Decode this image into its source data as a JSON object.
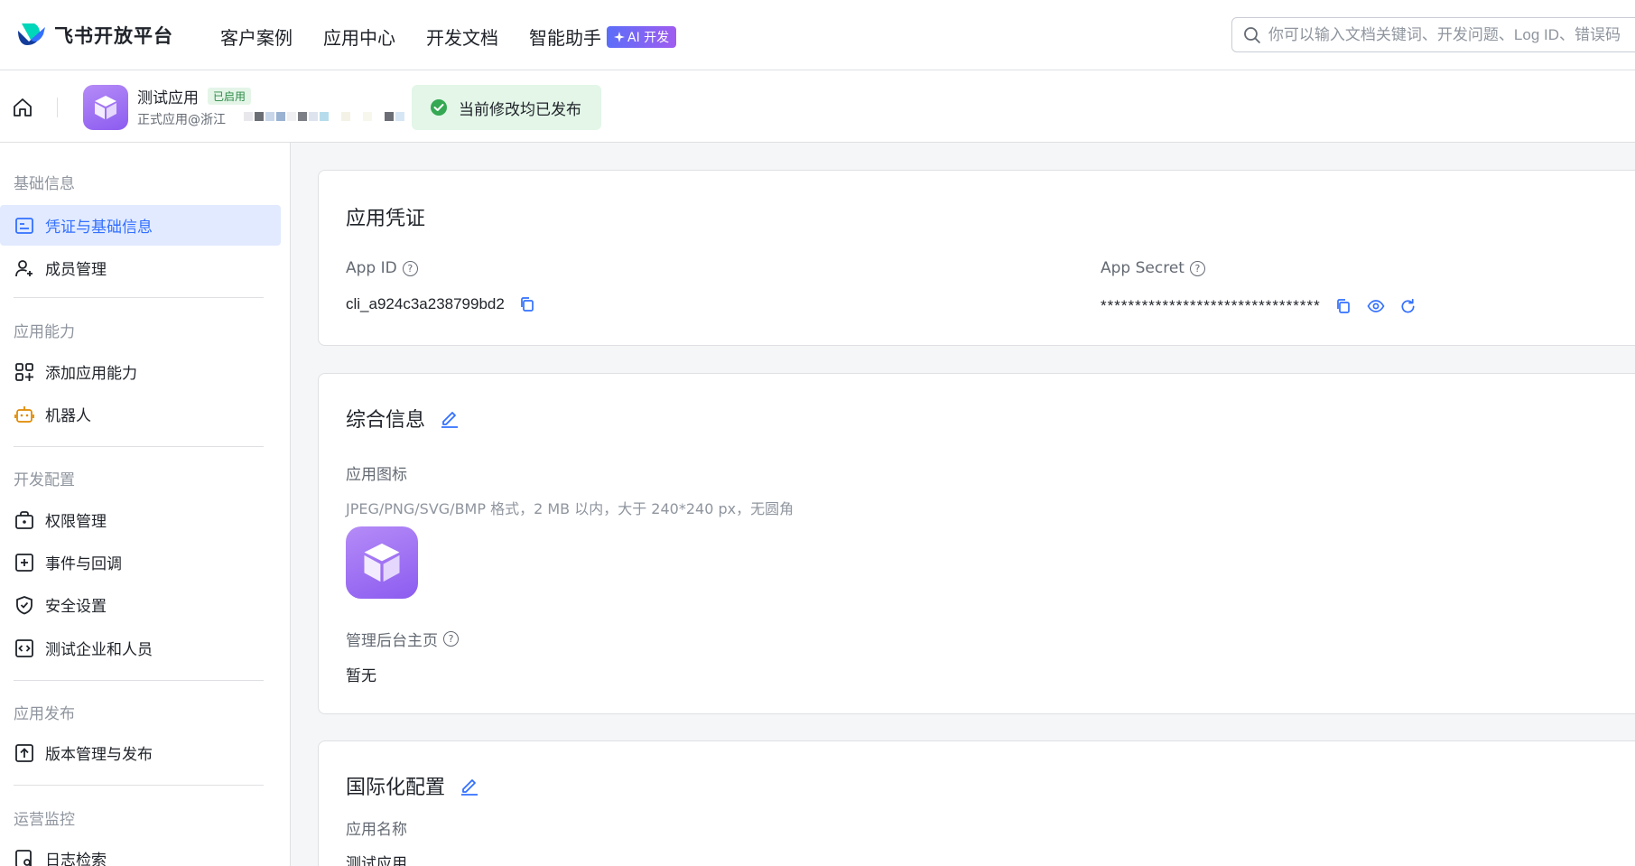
{
  "brand": {
    "name": "飞书开放平台"
  },
  "nav": {
    "items": [
      "客户案例",
      "应用中心",
      "开发文档",
      "智能助手"
    ],
    "ai_badge": "AI 开发"
  },
  "search": {
    "placeholder": "你可以输入文档关键词、开发问题、Log ID、错误码"
  },
  "app": {
    "name": "测试应用",
    "status": "已启用",
    "subtitle": "正式应用@浙江",
    "publish_status": "当前修改均已发布"
  },
  "sidebar": {
    "sections": [
      {
        "title": "基础信息",
        "items": [
          "凭证与基础信息",
          "成员管理"
        ]
      },
      {
        "title": "应用能力",
        "items": [
          "添加应用能力",
          "机器人"
        ]
      },
      {
        "title": "开发配置",
        "items": [
          "权限管理",
          "事件与回调",
          "安全设置",
          "测试企业和人员"
        ]
      },
      {
        "title": "应用发布",
        "items": [
          "版本管理与发布"
        ]
      },
      {
        "title": "运营监控",
        "items": [
          "日志检索"
        ]
      }
    ],
    "active_item": "凭证与基础信息"
  },
  "credentials": {
    "title": "应用凭证",
    "app_id_label": "App ID",
    "app_id_value": "cli_a924c3a238799bd2",
    "app_secret_label": "App Secret",
    "app_secret_value": "********************************"
  },
  "general": {
    "title": "综合信息",
    "icon_label": "应用图标",
    "icon_hint": "JPEG/PNG/SVG/BMP 格式，2 MB 以内，大于 240*240 px，无圆角",
    "admin_home_label": "管理后台主页",
    "admin_home_value": "暂无"
  },
  "i18n": {
    "title": "国际化配置",
    "app_name_label": "应用名称",
    "app_name_value": "测试应用"
  },
  "colors": {
    "accent": "#3370ff",
    "success": "#34a853",
    "app_purple": "#9a6cf3"
  }
}
